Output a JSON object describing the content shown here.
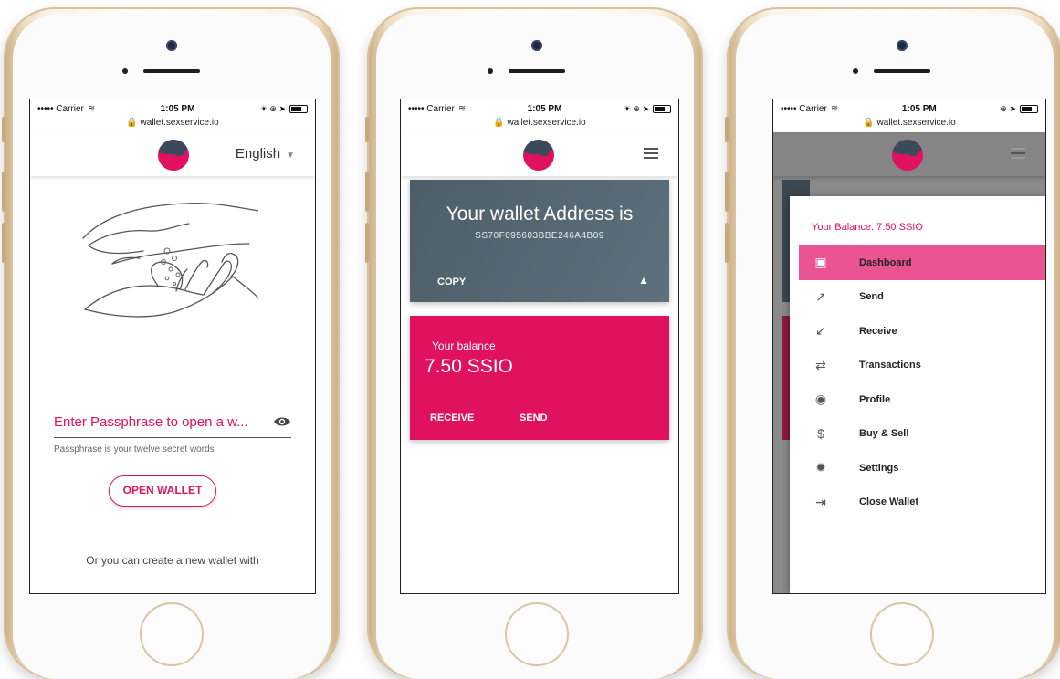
{
  "status": {
    "carrier": "••••• Carrier",
    "time": "1:05 PM",
    "url": "wallet.sexservice.io"
  },
  "phone1": {
    "language": "English",
    "passphrase_placeholder": "Enter Passphrase to open a w...",
    "helper": "Passphrase is your twelve secret words",
    "open_button": "OPEN WALLET",
    "create_text": "Or you can create a new wallet with"
  },
  "phone2": {
    "address_title": "Your wallet Address is",
    "address_value": "SS70F095603BBE246A4B09",
    "copy_label": "COPY",
    "balance_label": "Your balance",
    "balance_value": "7.50 SSIO",
    "receive_label": "RECEIVE",
    "send_label": "SEND"
  },
  "phone3": {
    "balance": "Your Balance: 7.50 SSIO",
    "menu": [
      {
        "label": "Dashboard",
        "icon": "wallet-icon",
        "glyph": "▣"
      },
      {
        "label": "Send",
        "icon": "arrow-up-right-icon",
        "glyph": "↗"
      },
      {
        "label": "Receive",
        "icon": "arrow-down-left-icon",
        "glyph": "↙"
      },
      {
        "label": "Transactions",
        "icon": "swap-icon",
        "glyph": "⇄"
      },
      {
        "label": "Profile",
        "icon": "account-icon",
        "glyph": "◉"
      },
      {
        "label": "Buy & Sell",
        "icon": "dollar-icon",
        "glyph": "$"
      },
      {
        "label": "Settings",
        "icon": "gear-icon",
        "glyph": "✹"
      },
      {
        "label": "Close Wallet",
        "icon": "exit-icon",
        "glyph": "⇥"
      }
    ],
    "active_index": 0
  },
  "colors": {
    "brand_pink": "#e0115f",
    "slate": "#52636e",
    "menu_active": "#ea5493"
  }
}
